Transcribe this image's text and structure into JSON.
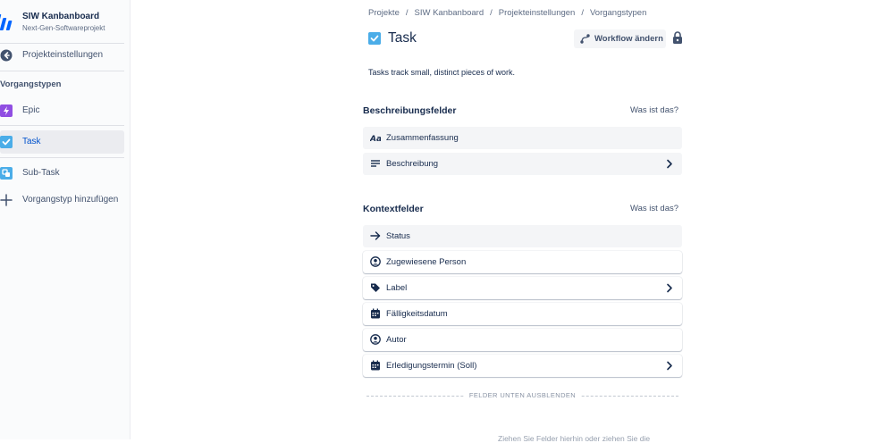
{
  "sidebar": {
    "project_name": "SIW Kanbanboard",
    "project_type": "Next-Gen-Softwareprojekt",
    "back_label": "Projekteinstellungen",
    "section_heading": "Vorgangstypen",
    "items": [
      {
        "label": "Epic",
        "icon": "epic-icon",
        "color": "#904ee2"
      },
      {
        "label": "Task",
        "icon": "task-icon",
        "color": "#4bade8",
        "active": true
      },
      {
        "label": "Sub-Task",
        "icon": "subtask-icon",
        "color": "#4bade8"
      },
      {
        "label": "Vorgangstyp hinzufügen",
        "icon": "plus-icon"
      }
    ]
  },
  "breadcrumb": [
    "Projekte",
    "SIW Kanbanboard",
    "Projekteinstellungen",
    "Vorgangstypen"
  ],
  "header": {
    "title": "Task",
    "workflow_button": "Workflow ändern",
    "description": "Tasks track small, distinct pieces of work."
  },
  "description_fields": {
    "title": "Beschreibungsfelder",
    "help_link": "Was ist das?",
    "items": [
      {
        "label": "Zusammenfassung",
        "icon": "text-format-icon",
        "locked": true
      },
      {
        "label": "Beschreibung",
        "icon": "paragraph-icon",
        "locked": true,
        "expandable": true
      }
    ]
  },
  "context_fields": {
    "title": "Kontextfelder",
    "help_link": "Was ist das?",
    "items": [
      {
        "label": "Status",
        "icon": "arrow-right-icon",
        "locked": true
      },
      {
        "label": "Zugewiesene Person",
        "icon": "person-icon"
      },
      {
        "label": "Label",
        "icon": "tag-icon",
        "expandable": true
      },
      {
        "label": "Fälligkeitsdatum",
        "icon": "calendar-icon"
      },
      {
        "label": "Autor",
        "icon": "person-icon"
      },
      {
        "label": "Erledigungstermin (Soll)",
        "icon": "calendar-icon",
        "expandable": true
      }
    ]
  },
  "hide_fields_label": "FELDER UNTEN AUSBLENDEN",
  "drop_hint": "Ziehen Sie Felder hierhin oder ziehen Sie die",
  "colors": {
    "accent": "#0052cc",
    "epic": "#904ee2",
    "task": "#4bade8",
    "text": "#172b4d",
    "muted": "#5e6c84"
  }
}
